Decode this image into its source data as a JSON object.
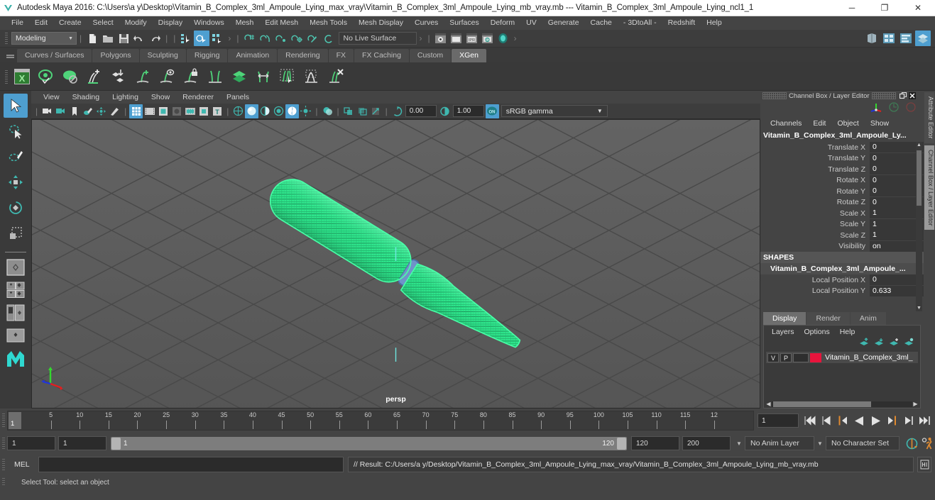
{
  "titlebar": {
    "app_title": "Autodesk Maya 2016: C:\\Users\\a y\\Desktop\\Vitamin_B_Complex_3ml_Ampoule_Lying_max_vray\\Vitamin_B_Complex_3ml_Ampoule_Lying_mb_vray.mb  ---  Vitamin_B_Complex_3ml_Ampoule_Lying_ncl1_1",
    "minimize": "─",
    "maximize": "❐",
    "close": "✕"
  },
  "menubar": {
    "items": [
      {
        "label": "File"
      },
      {
        "label": "Edit"
      },
      {
        "label": "Create"
      },
      {
        "label": "Select"
      },
      {
        "label": "Modify"
      },
      {
        "label": "Display"
      },
      {
        "label": "Windows"
      },
      {
        "label": "Mesh"
      },
      {
        "label": "Edit Mesh"
      },
      {
        "label": "Mesh Tools"
      },
      {
        "label": "Mesh Display"
      },
      {
        "label": "Curves"
      },
      {
        "label": "Surfaces"
      },
      {
        "label": "Deform"
      },
      {
        "label": "UV"
      },
      {
        "label": "Generate"
      },
      {
        "label": "Cache"
      },
      {
        "label": "- 3DtoAll -"
      },
      {
        "label": "Redshift"
      },
      {
        "label": "Help"
      }
    ]
  },
  "statusline": {
    "mode_menu_value": "Modeling",
    "live_surface_value": "No Live Surface",
    "icons": [
      "new-scene-icon",
      "open-scene-icon",
      "save-scene-icon",
      "undo-icon",
      "redo-icon",
      "select-by-hierarchy-icon",
      "select-by-object-icon",
      "select-by-component-icon",
      "snap-to-grid-icon",
      "snap-to-curve-icon",
      "snap-to-point-icon",
      "snap-to-projected-center-icon",
      "snap-to-view-plane-icon",
      "make-live-icon",
      "render-current-frame-icon",
      "ipr-render-icon",
      "render-sequence-icon",
      "render-settings-icon",
      "hypershade-icon",
      "render-view-icon",
      "show-hide-attribute-editor-icon",
      "show-hide-tool-settings-icon",
      "show-hide-channel-box-icon"
    ]
  },
  "shelf": {
    "tabs": [
      {
        "label": "Curves / Surfaces",
        "active": false
      },
      {
        "label": "Polygons",
        "active": false
      },
      {
        "label": "Sculpting",
        "active": false
      },
      {
        "label": "Rigging",
        "active": false
      },
      {
        "label": "Animation",
        "active": false
      },
      {
        "label": "Rendering",
        "active": false
      },
      {
        "label": "FX",
        "active": false
      },
      {
        "label": "FX Caching",
        "active": false
      },
      {
        "label": "Custom",
        "active": false
      },
      {
        "label": "XGen",
        "active": true
      }
    ],
    "icons": [
      "xgen-editor-icon",
      "xgen-preview-icon",
      "xgen-description-icon",
      "xgen-add-guides-icon",
      "xgen-place-icon",
      "xgen-add-grooming-icon",
      "xgen-eye-icon",
      "xgen-lock-icon",
      "xgen-part-icon",
      "xgen-layers-icon",
      "xgen-width-icon",
      "xgen-select-guides-icon",
      "xgen-clump-icon",
      "xgen-delete-icon"
    ]
  },
  "toolbox": {
    "tools": [
      {
        "name": "select-tool-icon",
        "selected": true
      },
      {
        "name": "lasso-select-tool-icon",
        "selected": false
      },
      {
        "name": "paint-select-tool-icon",
        "selected": false
      },
      {
        "name": "move-tool-icon",
        "selected": false
      },
      {
        "name": "rotate-tool-icon",
        "selected": false
      },
      {
        "name": "scale-tool-icon",
        "selected": false
      }
    ],
    "quick_layouts": [
      "single-perspective-layout-icon",
      "four-view-layout-icon",
      "persp-outliner-layout-icon",
      "persp-graph-layout-icon",
      "maya-logo-icon"
    ]
  },
  "viewport": {
    "menus": [
      {
        "label": "View"
      },
      {
        "label": "Shading"
      },
      {
        "label": "Lighting"
      },
      {
        "label": "Show"
      },
      {
        "label": "Renderer"
      },
      {
        "label": "Panels"
      }
    ],
    "camera_label": "persp",
    "exposure_value": "0.00",
    "gamma_value": "1.00",
    "color_management": "sRGB gamma",
    "background_color": "#5c5c5c",
    "grid_color": "#464646",
    "selection_color": "#33ed8f",
    "toolbar_icons": [
      "select-camera-icon",
      "lock-camera-icon",
      "bookmark-icon",
      "image-plane-icon",
      "two-d-pan-zoom-icon",
      "grease-pencil-icon",
      "grid-toggle-icon",
      "film-gate-icon",
      "resolution-gate-icon",
      "gate-mask-icon",
      "film-origin-icon",
      "safe-action-icon",
      "field-chart-icon",
      "wireframe-icon",
      "smooth-shade-all-icon",
      "shade-wireframe-icon",
      "use-default-material-icon",
      "texture-toggle-icon",
      "use-all-lights-icon",
      "shadow-toggle-icon",
      "screen-space-ao-icon",
      "motion-blur-icon",
      "multisample-icon",
      "isolate-select-icon",
      "xray-icon",
      "xray-joints-icon",
      "xray-active-components-icon",
      "exposure-icon",
      "gamma-icon",
      "color-management-toggle-icon"
    ]
  },
  "channelbox": {
    "panel_title": "Channel Box / Layer Editor",
    "undock_icon": "undock-icon",
    "close_icon": "close-icon",
    "gizmo_icons": [
      "manipulator-axis-icon",
      "rotate-gizmo-icon",
      "scale-gizmo-icon"
    ],
    "menus": [
      {
        "label": "Channels"
      },
      {
        "label": "Edit"
      },
      {
        "label": "Object"
      },
      {
        "label": "Show"
      }
    ],
    "object_name": "Vitamin_B_Complex_3ml_Ampoule_Ly...",
    "transform_channels": [
      {
        "label": "Translate X",
        "value": "0"
      },
      {
        "label": "Translate Y",
        "value": "0"
      },
      {
        "label": "Translate Z",
        "value": "0"
      },
      {
        "label": "Rotate X",
        "value": "0"
      },
      {
        "label": "Rotate Y",
        "value": "0"
      },
      {
        "label": "Rotate Z",
        "value": "0"
      },
      {
        "label": "Scale X",
        "value": "1"
      },
      {
        "label": "Scale Y",
        "value": "1"
      },
      {
        "label": "Scale Z",
        "value": "1"
      },
      {
        "label": "Visibility",
        "value": "on"
      }
    ],
    "shapes_header": "SHAPES",
    "shape_name": "Vitamin_B_Complex_3ml_Ampoule_...",
    "shape_channels": [
      {
        "label": "Local Position X",
        "value": "0"
      },
      {
        "label": "Local Position Y",
        "value": "0.633"
      }
    ]
  },
  "layereditor": {
    "tabs": [
      {
        "label": "Display",
        "active": true
      },
      {
        "label": "Render",
        "active": false
      },
      {
        "label": "Anim",
        "active": false
      }
    ],
    "menus": [
      {
        "label": "Layers"
      },
      {
        "label": "Options"
      },
      {
        "label": "Help"
      }
    ],
    "toolbar_icons": [
      "move-layer-up-icon",
      "move-layer-down-icon",
      "new-layer-icon",
      "new-layer-from-selected-icon"
    ],
    "layers": [
      {
        "visibility": "V",
        "playback": "P",
        "type": "",
        "color": "#e8143c",
        "name": "Vitamin_B_Complex_3ml_"
      }
    ]
  },
  "vtabs": [
    {
      "label": "Attribute Editor",
      "active": false
    },
    {
      "label": "Channel Box / Layer Editor",
      "active": true
    }
  ],
  "timeslider": {
    "tick_labels": [
      "5",
      "10",
      "15",
      "20",
      "25",
      "30",
      "35",
      "40",
      "45",
      "50",
      "55",
      "60",
      "65",
      "70",
      "75",
      "80",
      "85",
      "90",
      "95",
      "100",
      "105",
      "110",
      "115",
      "12"
    ],
    "current_frame": "1",
    "frame_field": "1",
    "playback_icons": [
      "go-to-start-icon",
      "step-back-keyframe-icon",
      "step-back-frame-icon",
      "play-backwards-icon",
      "play-forwards-icon",
      "step-forward-frame-icon",
      "step-forward-keyframe-icon",
      "go-to-end-icon"
    ]
  },
  "rangeslider": {
    "anim_start": "1",
    "range_start": "1",
    "bar_start_label": "1",
    "bar_end_label": "120",
    "range_end": "120",
    "anim_end": "200",
    "anim_layer": "No Anim Layer",
    "character_set": "No Character Set",
    "auto_keyframe_icon": "auto-keyframe-icon",
    "animation_preferences_icon": "animation-preferences-icon"
  },
  "commandline": {
    "label": "MEL",
    "input_value": "",
    "input_placeholder": "",
    "result_text": "// Result: C:/Users/a y/Desktop/Vitamin_B_Complex_3ml_Ampoule_Lying_max_vray/Vitamin_B_Complex_3ml_Ampoule_Lying_mb_vray.mb",
    "script_editor_icon": "script-editor-icon"
  },
  "helpline": {
    "text": "Select Tool: select an object"
  }
}
